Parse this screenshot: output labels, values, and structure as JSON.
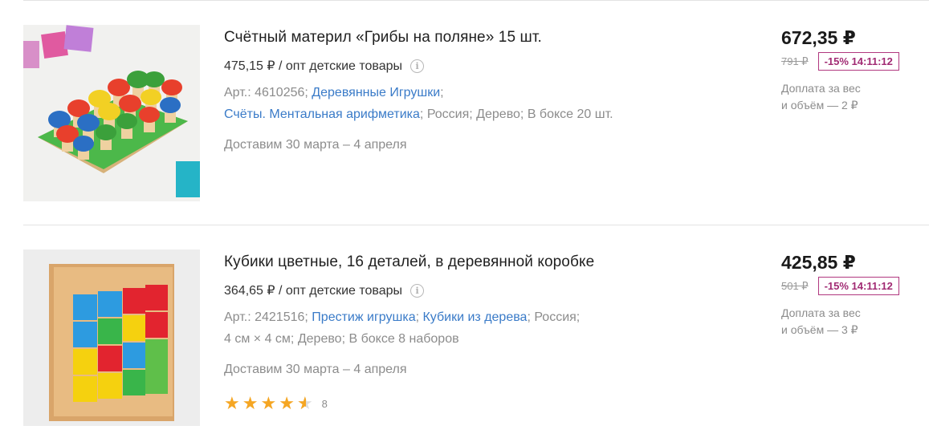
{
  "products": [
    {
      "title": "Счётный материл «Грибы на поляне» 15 шт.",
      "wholesale": "475,15 ₽ / опт детские товары",
      "article": "Арт.: 4610256; ",
      "cat1": "Деревянные Игрушки",
      "sep1": ";",
      "cat2": "Счёты. Ментальная арифметика",
      "tail": "; Россия; Дерево; В боксе 20 шт.",
      "delivery": "Доставим 30 марта – 4 апреля",
      "price": "672,35 ₽",
      "old_price": "791 ₽",
      "promo": "-15% 14:11:12",
      "extra_line1": "Доплата за вес",
      "extra_line2": "и объём — 2 ₽"
    },
    {
      "title": "Кубики цветные, 16 деталей, в деревянной коробке",
      "wholesale": "364,65 ₽ / опт детские товары",
      "article": "Арт.: 2421516; ",
      "cat1": "Престиж игрушка",
      "sep1": "; ",
      "cat2": "Кубики из дерева",
      "tail": "; Россия;",
      "tail2": "4 см × 4 см; Дерево; В боксе 8 наборов",
      "delivery": "Доставим 30 марта – 4 апреля",
      "price": "425,85 ₽",
      "old_price": "501 ₽",
      "promo": "-15% 14:11:12",
      "extra_line1": "Доплата за вес",
      "extra_line2": "и объём — 3 ₽",
      "rating": 4.5,
      "reviews": "8"
    }
  ],
  "icons": {
    "info": "info-icon",
    "star": "star-icon"
  },
  "colors": {
    "link": "#3a7bc8",
    "promo": "#a12a73",
    "star": "#f5a623"
  }
}
